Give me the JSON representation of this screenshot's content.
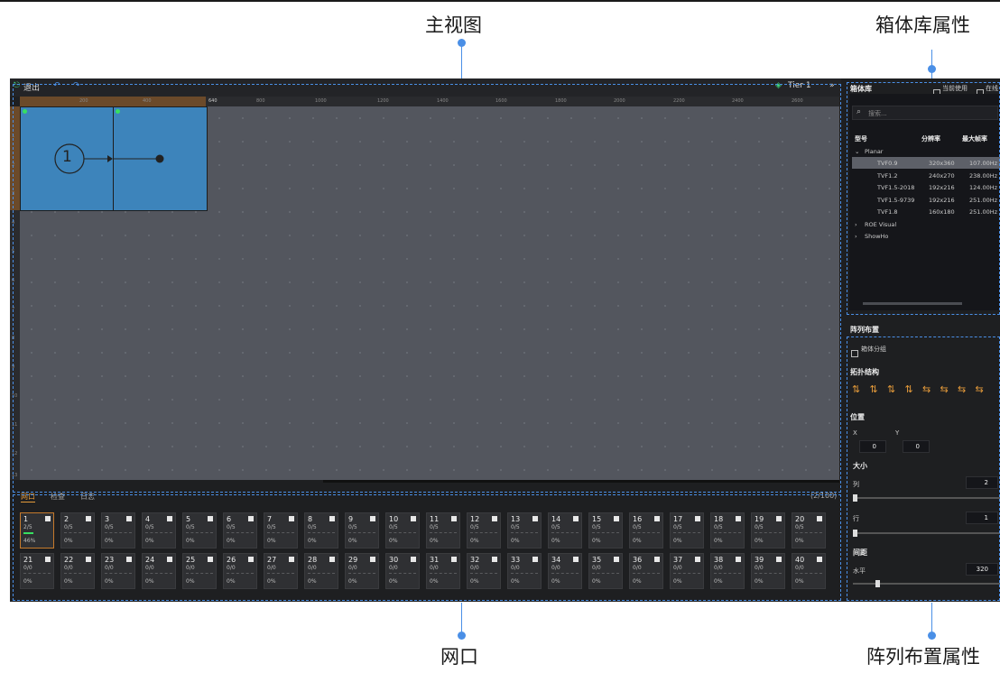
{
  "callouts": {
    "main_view": "主视图",
    "library_props": "箱体库属性",
    "net_port": "网口",
    "array_props": "阵列布置属性"
  },
  "toolbar": {
    "exit_label": "退出",
    "tier_label": "Tier 1",
    "expand_icon": "»"
  },
  "ruler": {
    "top_ticks": [
      "200",
      "400",
      "640",
      "800",
      "1000",
      "1200",
      "1400",
      "1600",
      "1800",
      "2000",
      "2200",
      "2400",
      "2600"
    ],
    "left_ticks": [
      "1",
      "2",
      "3",
      "4",
      "5",
      "6",
      "7",
      "8",
      "9",
      "10",
      "11",
      "12",
      "13"
    ]
  },
  "canvas": {
    "cabinet_label": "1"
  },
  "bottom_tabs": {
    "net_port": "网口",
    "monitor": "检查",
    "log": "日志",
    "count": "(2/100)"
  },
  "ports_row1": [
    {
      "n": "1",
      "count": "2/5",
      "pct": "46%"
    },
    {
      "n": "2",
      "count": "0/5",
      "pct": "0%"
    },
    {
      "n": "3",
      "count": "0/5",
      "pct": "0%"
    },
    {
      "n": "4",
      "count": "0/5",
      "pct": "0%"
    },
    {
      "n": "5",
      "count": "0/5",
      "pct": "0%"
    },
    {
      "n": "6",
      "count": "0/5",
      "pct": "0%"
    },
    {
      "n": "7",
      "count": "0/5",
      "pct": "0%"
    },
    {
      "n": "8",
      "count": "0/5",
      "pct": "0%"
    },
    {
      "n": "9",
      "count": "0/5",
      "pct": "0%"
    },
    {
      "n": "10",
      "count": "0/5",
      "pct": "0%"
    },
    {
      "n": "11",
      "count": "0/5",
      "pct": "0%"
    },
    {
      "n": "12",
      "count": "0/5",
      "pct": "0%"
    },
    {
      "n": "13",
      "count": "0/5",
      "pct": "0%"
    },
    {
      "n": "14",
      "count": "0/5",
      "pct": "0%"
    },
    {
      "n": "15",
      "count": "0/5",
      "pct": "0%"
    },
    {
      "n": "16",
      "count": "0/5",
      "pct": "0%"
    },
    {
      "n": "17",
      "count": "0/5",
      "pct": "0%"
    },
    {
      "n": "18",
      "count": "0/5",
      "pct": "0%"
    },
    {
      "n": "19",
      "count": "0/5",
      "pct": "0%"
    },
    {
      "n": "20",
      "count": "0/5",
      "pct": "0%"
    }
  ],
  "ports_row2": [
    {
      "n": "21",
      "count": "0/0",
      "pct": "0%"
    },
    {
      "n": "22",
      "count": "0/0",
      "pct": "0%"
    },
    {
      "n": "23",
      "count": "0/0",
      "pct": "0%"
    },
    {
      "n": "24",
      "count": "0/0",
      "pct": "0%"
    },
    {
      "n": "25",
      "count": "0/0",
      "pct": "0%"
    },
    {
      "n": "26",
      "count": "0/0",
      "pct": "0%"
    },
    {
      "n": "27",
      "count": "0/0",
      "pct": "0%"
    },
    {
      "n": "28",
      "count": "0/0",
      "pct": "0%"
    },
    {
      "n": "29",
      "count": "0/0",
      "pct": "0%"
    },
    {
      "n": "30",
      "count": "0/0",
      "pct": "0%"
    },
    {
      "n": "31",
      "count": "0/0",
      "pct": "0%"
    },
    {
      "n": "32",
      "count": "0/0",
      "pct": "0%"
    },
    {
      "n": "33",
      "count": "0/0",
      "pct": "0%"
    },
    {
      "n": "34",
      "count": "0/0",
      "pct": "0%"
    },
    {
      "n": "35",
      "count": "0/0",
      "pct": "0%"
    },
    {
      "n": "36",
      "count": "0/0",
      "pct": "0%"
    },
    {
      "n": "37",
      "count": "0/0",
      "pct": "0%"
    },
    {
      "n": "38",
      "count": "0/0",
      "pct": "0%"
    },
    {
      "n": "39",
      "count": "0/0",
      "pct": "0%"
    },
    {
      "n": "40",
      "count": "0/0",
      "pct": "0%"
    }
  ],
  "library": {
    "title": "箱体库",
    "current_use": "当前使用",
    "online": "在线",
    "search_placeholder": "搜索...",
    "col_model": "型号",
    "col_resolution": "分辨率",
    "col_max_rate": "最大帧率",
    "group_planar": "Planar",
    "items": [
      {
        "model": "TVF0.9",
        "res": "320x360",
        "rate": "107.00Hz"
      },
      {
        "model": "TVF1.2",
        "res": "240x270",
        "rate": "238.00Hz"
      },
      {
        "model": "TVF1.5-2018",
        "res": "192x216",
        "rate": "124.00Hz"
      },
      {
        "model": "TVF1.5-9739",
        "res": "192x216",
        "rate": "251.00Hz"
      },
      {
        "model": "TVF1.8",
        "res": "160x180",
        "rate": "251.00Hz"
      }
    ],
    "group_roe": "ROE Visual",
    "group_showho": "ShowHo"
  },
  "array": {
    "title": "阵列布置",
    "cabinet_group": "箱体分组",
    "topology": "拓扑结构",
    "position": "位置",
    "x_label": "X",
    "y_label": "Y",
    "x_value": "0",
    "y_value": "0",
    "size": "大小",
    "cols_label": "列",
    "cols_value": "2",
    "rows_label": "行",
    "rows_value": "1",
    "spacing": "间距",
    "horizontal_label": "水平",
    "horizontal_value": "320"
  },
  "colors": {
    "accent": "#4a8fe6",
    "cabinet": "#3d84bb",
    "selection": "#c57a2c"
  }
}
